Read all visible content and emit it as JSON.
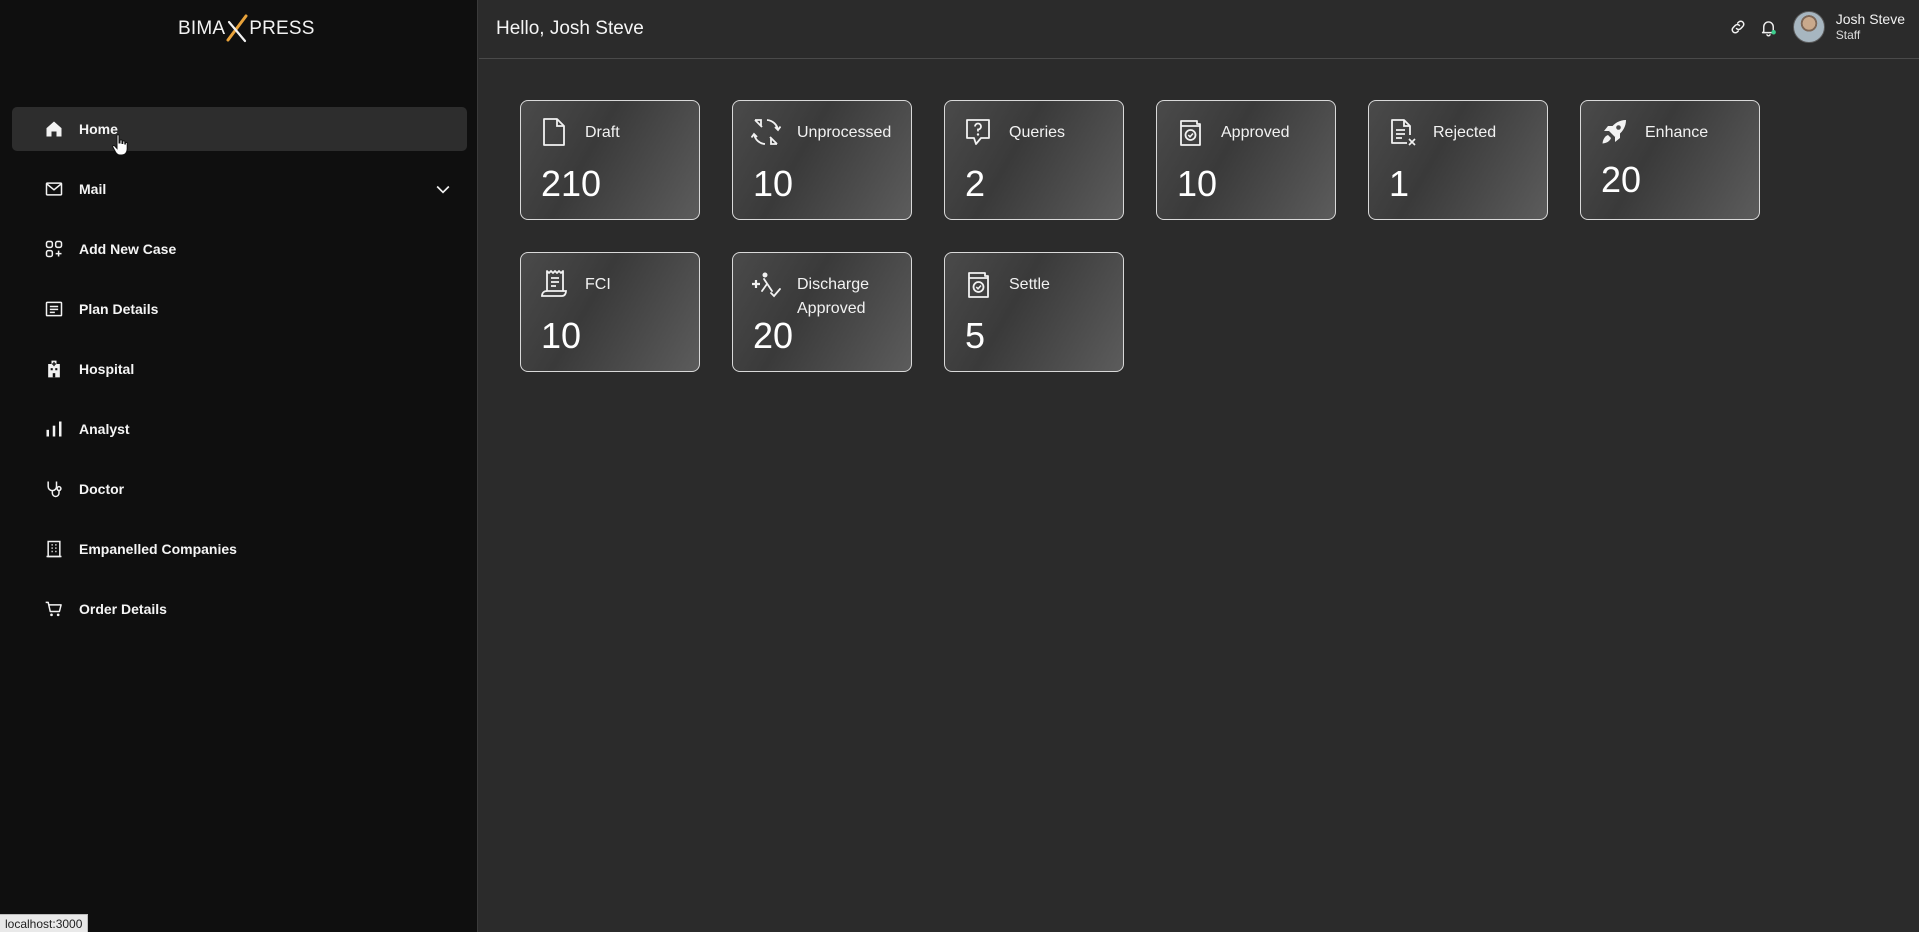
{
  "logo": {
    "left": "BIMA",
    "right": "PRESS"
  },
  "sidebar": {
    "items": [
      {
        "label": "Home",
        "icon": "home-icon",
        "active": true
      },
      {
        "label": "Mail",
        "icon": "mail-icon",
        "expandable": true
      },
      {
        "label": "Add New Case",
        "icon": "add-case-icon"
      },
      {
        "label": "Plan Details",
        "icon": "plan-details-icon"
      },
      {
        "label": "Hospital",
        "icon": "hospital-icon"
      },
      {
        "label": "Analyst",
        "icon": "bar-chart-icon"
      },
      {
        "label": "Doctor",
        "icon": "stethoscope-icon"
      },
      {
        "label": "Empanelled Companies",
        "icon": "building-icon"
      },
      {
        "label": "Order Details",
        "icon": "cart-icon"
      }
    ]
  },
  "header": {
    "greeting": "Hello, Josh Steve",
    "user": {
      "name": "Josh Steve",
      "role": "Staff"
    }
  },
  "cards": [
    {
      "label": "Draft",
      "value": "210",
      "icon": "document-icon"
    },
    {
      "label": "Unprocessed",
      "value": "10",
      "icon": "refresh-arrows-icon"
    },
    {
      "label": "Queries",
      "value": "2",
      "icon": "question-bubble-icon"
    },
    {
      "label": "Approved",
      "value": "10",
      "icon": "approved-folder-icon"
    },
    {
      "label": "Rejected",
      "value": "1",
      "icon": "rejected-document-icon"
    },
    {
      "label": "Enhance",
      "value": "20",
      "icon": "rocket-icon"
    },
    {
      "label": "FCI",
      "value": "10",
      "icon": "receipt-icon"
    },
    {
      "label": "Discharge Approved",
      "value": "20",
      "icon": "discharge-icon"
    },
    {
      "label": "Settle",
      "value": "5",
      "icon": "settle-folder-icon"
    }
  ],
  "status_bar": {
    "url": "localhost:3000"
  },
  "colors": {
    "sidebar_bg": "#0f0f0f",
    "main_bg": "#2b2b2b",
    "logo_accent": "#e8a23a",
    "notify_dot": "#3ecf8e"
  }
}
